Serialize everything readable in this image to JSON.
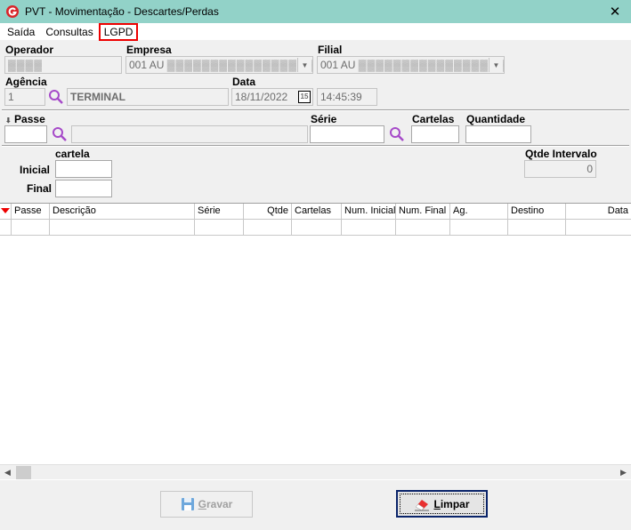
{
  "window": {
    "title": "PVT - Movimentação  - Descartes/Perdas",
    "close_glyph": "✕"
  },
  "menu": {
    "items": [
      "Saída",
      "Consultas",
      "LGPD"
    ],
    "highlighted": "LGPD"
  },
  "form": {
    "operador": {
      "label": "Operador",
      "value": "▓▓▓▓"
    },
    "empresa": {
      "label": "Empresa",
      "value": "001 AU",
      "redacted": "▓▓▓▓▓▓▓▓▓▓▓▓▓▓▓▓▓▓▓▓"
    },
    "filial": {
      "label": "Filial",
      "value": "001 AU",
      "redacted": "▓▓▓▓▓▓▓▓▓▓▓▓▓▓▓▓▓▓▓▓"
    },
    "agencia": {
      "label": "Agência",
      "code": "1",
      "name": "TERMINAL"
    },
    "data": {
      "label": "Data",
      "date": "18/11/2022",
      "time": "14:45:39",
      "cal_day": "15"
    },
    "passe": {
      "label": "Passe",
      "value": "",
      "desc": ""
    },
    "serie": {
      "label": "Série",
      "value": ""
    },
    "cartelas": {
      "label": "Cartelas",
      "value": ""
    },
    "quantidade": {
      "label": "Quantidade",
      "value": ""
    },
    "cartela": {
      "label": "cartela",
      "inicial_label": "Inicial",
      "final_label": "Final",
      "inicial": "",
      "final": ""
    },
    "qtde_intervalo": {
      "label": "Qtde Intervalo",
      "value": "0"
    }
  },
  "grid": {
    "columns": [
      "Passe",
      "Descrição",
      "Série",
      "Qtde",
      "Cartelas",
      "Num. Inicial",
      "Num. Final",
      "Ag.",
      "Destino",
      "Data"
    ]
  },
  "buttons": {
    "gravar": "Gravar",
    "limpar": "Limpar"
  },
  "colors": {
    "titlebar": "#92d2c8",
    "highlight": "#e00000",
    "search_icon": "#a64ac9"
  }
}
